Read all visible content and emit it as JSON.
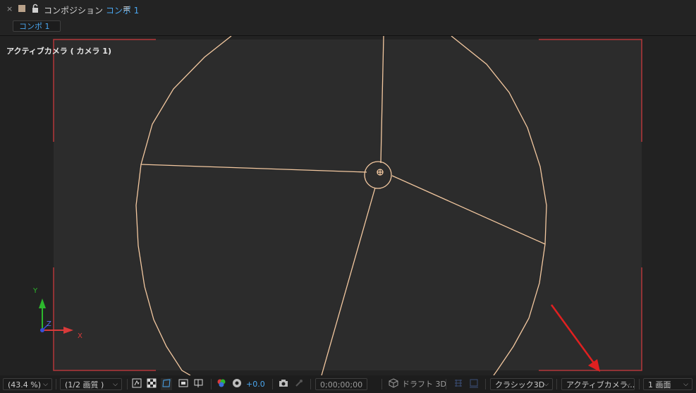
{
  "header": {
    "close_glyph": "×",
    "panel_prefix": "コンポジション ",
    "comp_name": "コンポ 1",
    "menu_glyph": "≡"
  },
  "tab": {
    "label": "コンポ 1"
  },
  "viewer": {
    "view_label": "アクティブカメラ ( カメラ 1)",
    "axis_labels": {
      "y": "Y",
      "z": "Z",
      "x": "X"
    },
    "colors": {
      "frame_corner": "#b3373a",
      "camera_wire": "#f3c8a0",
      "comp_bg": "#2c2c2c",
      "axis_y": "#2db82d",
      "axis_x": "#d83a3a",
      "axis_z": "#3a4fd8"
    }
  },
  "statusbar": {
    "zoom": "(43.4 %)",
    "resolution": "(1/2 画質 )",
    "exposure": "+0.0",
    "timecode": "0;00;00;00",
    "draft_3d": "ドラフト 3D",
    "renderer": "クラシック3D",
    "active_camera": "アクティブカメラ...",
    "view_layout": "1 画面"
  }
}
